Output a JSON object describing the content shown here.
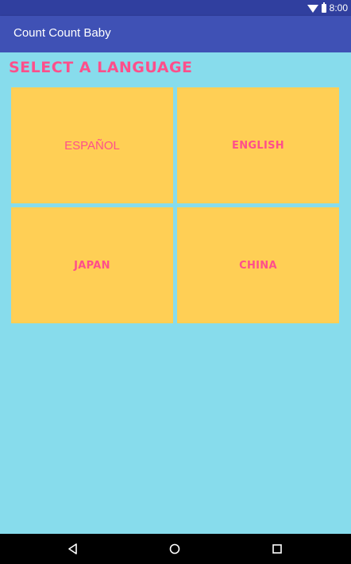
{
  "status_bar": {
    "time": "8:00",
    "icons": [
      "wifi-icon",
      "battery-icon"
    ]
  },
  "app_bar": {
    "title": "Count Count Baby"
  },
  "main": {
    "heading": "SELECT A LANGUAGE",
    "languages": [
      {
        "label": "ESPAÑOL"
      },
      {
        "label": "ENGLISH"
      },
      {
        "label": "JAPAN"
      },
      {
        "label": "CHINA"
      }
    ]
  },
  "nav_bar": {
    "buttons": [
      "back-icon",
      "home-icon",
      "recents-icon"
    ]
  },
  "colors": {
    "status_bar": "#303f9f",
    "app_bar": "#3f51b5",
    "background": "#87dcec",
    "tile": "#ffcf55",
    "accent_text": "#ff4f8b",
    "nav_bar": "#000000"
  }
}
